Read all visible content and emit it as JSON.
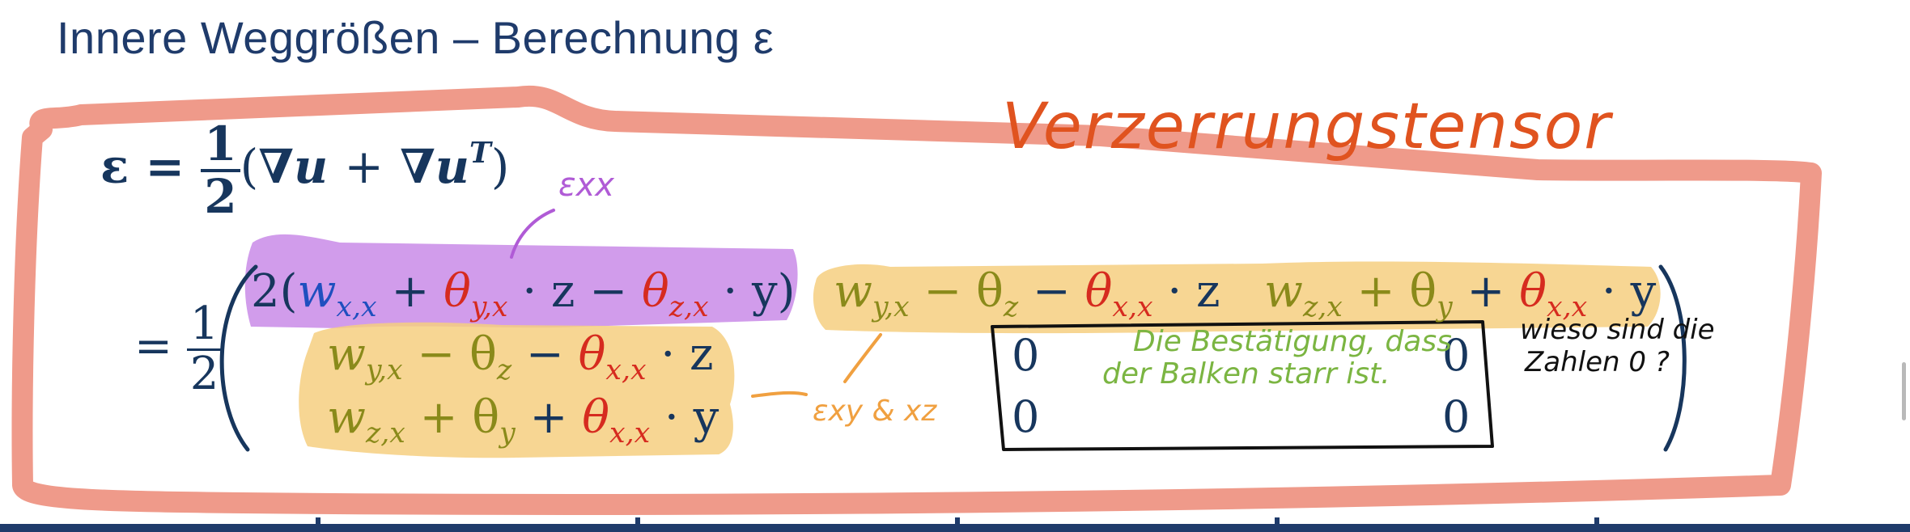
{
  "slide": {
    "title": "Innere Weggrößen – Berechnung ε"
  },
  "equation": {
    "eps": "ε",
    "eq": "=",
    "one": "1",
    "two": "2",
    "lparen": "(",
    "rparen": ")",
    "nabla_u": "∇u",
    "plus": "+",
    "nabla_uT_base": "∇u",
    "T": "T",
    "row1_col1": {
      "pre": "2(",
      "w": "w",
      "w_sub": "x,x",
      "plus": "+",
      "theta1": "θ",
      "theta1_sub": "y,x",
      "dot_z": "· z −",
      "theta2": "θ",
      "theta2_sub": "z,x",
      "dot_y": "· y)"
    },
    "row1_col2": {
      "w": "w",
      "w_sub": "y,x",
      "minus1": "− θ",
      "theta_z_sub": "z",
      "minus2": "−",
      "theta": "θ",
      "theta_sub": "x,x",
      "tail": "· z"
    },
    "row1_col3": {
      "w": "w",
      "w_sub": "z,x",
      "plus1": "+ θ",
      "theta_y_sub": "y",
      "plus2": "+",
      "theta": "θ",
      "theta_sub": "x,x",
      "tail": "· y"
    },
    "row2_col1": {
      "w": "w",
      "w_sub": "y,x",
      "minus1": "− θ",
      "theta_z_sub": "z",
      "minus2": "−",
      "theta": "θ",
      "theta_sub": "x,x",
      "tail": "· z"
    },
    "row3_col1": {
      "w": "w",
      "w_sub": "z,x",
      "plus1": "+ θ",
      "theta_y_sub": "y",
      "plus2": "+",
      "theta": "θ",
      "theta_sub": "x,x",
      "tail": "· y"
    },
    "zeros": [
      "0",
      "0",
      "0",
      "0"
    ]
  },
  "annotations": {
    "verzerrungstensor": "Verzerrungstensor",
    "exx": "εxx",
    "exy_xz": "εxy & xz",
    "bestaetigung_line1": "Die Bestätigung, dass",
    "bestaetigung_line2": "der Balken starr ist.",
    "question_line1": "wieso sind die",
    "question_line2": "Zahlen 0 ?"
  },
  "colors": {
    "title": "#1f3b6b",
    "math_navy": "#17365d",
    "math_blue": "#1f4fbf",
    "math_red": "#d62b1f",
    "math_olive": "#8a8a1a",
    "frame_salmon": "#ef9a8a",
    "highlight_purple": "#c98be8",
    "highlight_yellow": "#f6cf80",
    "ink_orange": "#e0531f",
    "ink_violet": "#b05bd6",
    "ink_green": "#7bb542",
    "ink_black": "#111111"
  }
}
